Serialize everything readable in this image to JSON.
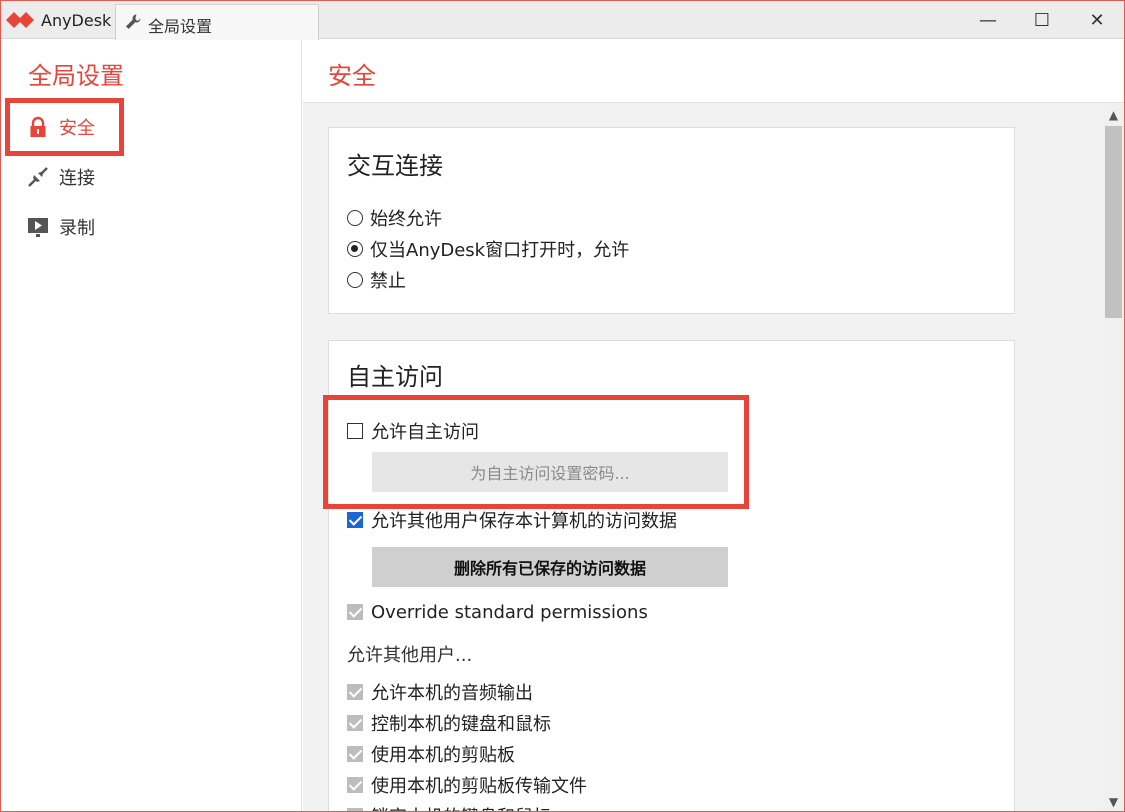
{
  "titlebar": {
    "app_name": "AnyDesk",
    "tab_label": "全局设置",
    "minimize": "—",
    "maximize": "☐",
    "close": "✕"
  },
  "sidebar": {
    "title": "全局设置",
    "items": [
      {
        "label": "安全",
        "icon": "lock-icon",
        "active": true
      },
      {
        "label": "连接",
        "icon": "connection-icon",
        "active": false
      },
      {
        "label": "录制",
        "icon": "recording-icon",
        "active": false
      }
    ]
  },
  "main": {
    "title": "安全",
    "interactive_access": {
      "title": "交互连接",
      "options": [
        {
          "label": "始终允许",
          "selected": false
        },
        {
          "label": "仅当AnyDesk窗口打开时，允许",
          "selected": true
        },
        {
          "label": "禁止",
          "selected": false
        }
      ]
    },
    "unattended_access": {
      "title": "自主访问",
      "enable_label": "允许自主访问",
      "set_password_button": "为自主访问设置密码...",
      "allow_save_label": "允许其他用户保存本计算机的访问数据",
      "delete_saved_button": "删除所有已保存的访问数据",
      "override_label": "Override standard permissions",
      "allow_others_label": "允许其他用户...",
      "permissions": [
        "允许本机的音频输出",
        "控制本机的键盘和鼠标",
        "使用本机的剪贴板",
        "使用本机的剪贴板传输文件",
        "锁定本机的键盘和鼠标"
      ]
    }
  },
  "colors": {
    "accent": "#e8443a",
    "checkbox_blue": "#1a66d6",
    "checkbox_gray": "#bdbdbd"
  }
}
